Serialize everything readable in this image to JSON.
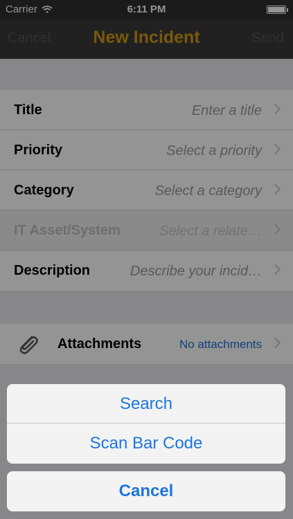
{
  "status_bar": {
    "carrier": "Carrier",
    "time": "6:11 PM",
    "battery_level": 1.0
  },
  "nav": {
    "cancel_label": "Cancel",
    "title": "New Incident",
    "send_label": "Send"
  },
  "form": {
    "rows": [
      {
        "label": "Title",
        "value": "Enter a title"
      },
      {
        "label": "Priority",
        "value": "Select a priority"
      },
      {
        "label": "Category",
        "value": "Select a category"
      },
      {
        "label": "IT Asset/System",
        "value": "Select a relate…"
      },
      {
        "label": "Description",
        "value": "Describe your incid…"
      }
    ]
  },
  "attachments": {
    "label": "Attachments",
    "value": "No attachments"
  },
  "action_sheet": {
    "options": [
      "Search",
      "Scan Bar Code"
    ],
    "cancel_label": "Cancel"
  },
  "colors": {
    "accent": "#d39a12",
    "link": "#1d76dd"
  }
}
